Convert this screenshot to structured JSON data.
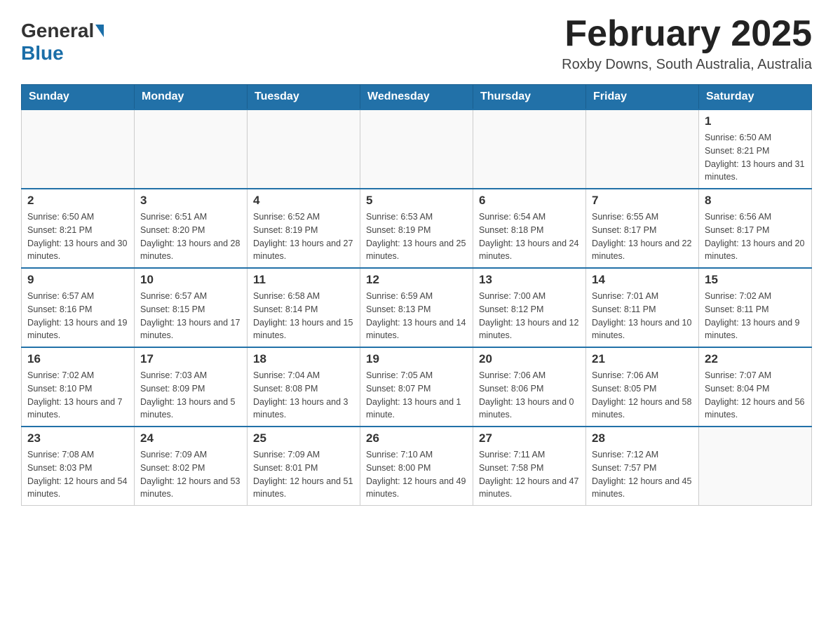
{
  "logo": {
    "general": "General",
    "blue": "Blue"
  },
  "title": "February 2025",
  "subtitle": "Roxby Downs, South Australia, Australia",
  "days_of_week": [
    "Sunday",
    "Monday",
    "Tuesday",
    "Wednesday",
    "Thursday",
    "Friday",
    "Saturday"
  ],
  "weeks": [
    [
      {
        "day": "",
        "info": ""
      },
      {
        "day": "",
        "info": ""
      },
      {
        "day": "",
        "info": ""
      },
      {
        "day": "",
        "info": ""
      },
      {
        "day": "",
        "info": ""
      },
      {
        "day": "",
        "info": ""
      },
      {
        "day": "1",
        "info": "Sunrise: 6:50 AM\nSunset: 8:21 PM\nDaylight: 13 hours and 31 minutes."
      }
    ],
    [
      {
        "day": "2",
        "info": "Sunrise: 6:50 AM\nSunset: 8:21 PM\nDaylight: 13 hours and 30 minutes."
      },
      {
        "day": "3",
        "info": "Sunrise: 6:51 AM\nSunset: 8:20 PM\nDaylight: 13 hours and 28 minutes."
      },
      {
        "day": "4",
        "info": "Sunrise: 6:52 AM\nSunset: 8:19 PM\nDaylight: 13 hours and 27 minutes."
      },
      {
        "day": "5",
        "info": "Sunrise: 6:53 AM\nSunset: 8:19 PM\nDaylight: 13 hours and 25 minutes."
      },
      {
        "day": "6",
        "info": "Sunrise: 6:54 AM\nSunset: 8:18 PM\nDaylight: 13 hours and 24 minutes."
      },
      {
        "day": "7",
        "info": "Sunrise: 6:55 AM\nSunset: 8:17 PM\nDaylight: 13 hours and 22 minutes."
      },
      {
        "day": "8",
        "info": "Sunrise: 6:56 AM\nSunset: 8:17 PM\nDaylight: 13 hours and 20 minutes."
      }
    ],
    [
      {
        "day": "9",
        "info": "Sunrise: 6:57 AM\nSunset: 8:16 PM\nDaylight: 13 hours and 19 minutes."
      },
      {
        "day": "10",
        "info": "Sunrise: 6:57 AM\nSunset: 8:15 PM\nDaylight: 13 hours and 17 minutes."
      },
      {
        "day": "11",
        "info": "Sunrise: 6:58 AM\nSunset: 8:14 PM\nDaylight: 13 hours and 15 minutes."
      },
      {
        "day": "12",
        "info": "Sunrise: 6:59 AM\nSunset: 8:13 PM\nDaylight: 13 hours and 14 minutes."
      },
      {
        "day": "13",
        "info": "Sunrise: 7:00 AM\nSunset: 8:12 PM\nDaylight: 13 hours and 12 minutes."
      },
      {
        "day": "14",
        "info": "Sunrise: 7:01 AM\nSunset: 8:11 PM\nDaylight: 13 hours and 10 minutes."
      },
      {
        "day": "15",
        "info": "Sunrise: 7:02 AM\nSunset: 8:11 PM\nDaylight: 13 hours and 9 minutes."
      }
    ],
    [
      {
        "day": "16",
        "info": "Sunrise: 7:02 AM\nSunset: 8:10 PM\nDaylight: 13 hours and 7 minutes."
      },
      {
        "day": "17",
        "info": "Sunrise: 7:03 AM\nSunset: 8:09 PM\nDaylight: 13 hours and 5 minutes."
      },
      {
        "day": "18",
        "info": "Sunrise: 7:04 AM\nSunset: 8:08 PM\nDaylight: 13 hours and 3 minutes."
      },
      {
        "day": "19",
        "info": "Sunrise: 7:05 AM\nSunset: 8:07 PM\nDaylight: 13 hours and 1 minute."
      },
      {
        "day": "20",
        "info": "Sunrise: 7:06 AM\nSunset: 8:06 PM\nDaylight: 13 hours and 0 minutes."
      },
      {
        "day": "21",
        "info": "Sunrise: 7:06 AM\nSunset: 8:05 PM\nDaylight: 12 hours and 58 minutes."
      },
      {
        "day": "22",
        "info": "Sunrise: 7:07 AM\nSunset: 8:04 PM\nDaylight: 12 hours and 56 minutes."
      }
    ],
    [
      {
        "day": "23",
        "info": "Sunrise: 7:08 AM\nSunset: 8:03 PM\nDaylight: 12 hours and 54 minutes."
      },
      {
        "day": "24",
        "info": "Sunrise: 7:09 AM\nSunset: 8:02 PM\nDaylight: 12 hours and 53 minutes."
      },
      {
        "day": "25",
        "info": "Sunrise: 7:09 AM\nSunset: 8:01 PM\nDaylight: 12 hours and 51 minutes."
      },
      {
        "day": "26",
        "info": "Sunrise: 7:10 AM\nSunset: 8:00 PM\nDaylight: 12 hours and 49 minutes."
      },
      {
        "day": "27",
        "info": "Sunrise: 7:11 AM\nSunset: 7:58 PM\nDaylight: 12 hours and 47 minutes."
      },
      {
        "day": "28",
        "info": "Sunrise: 7:12 AM\nSunset: 7:57 PM\nDaylight: 12 hours and 45 minutes."
      },
      {
        "day": "",
        "info": ""
      }
    ]
  ]
}
